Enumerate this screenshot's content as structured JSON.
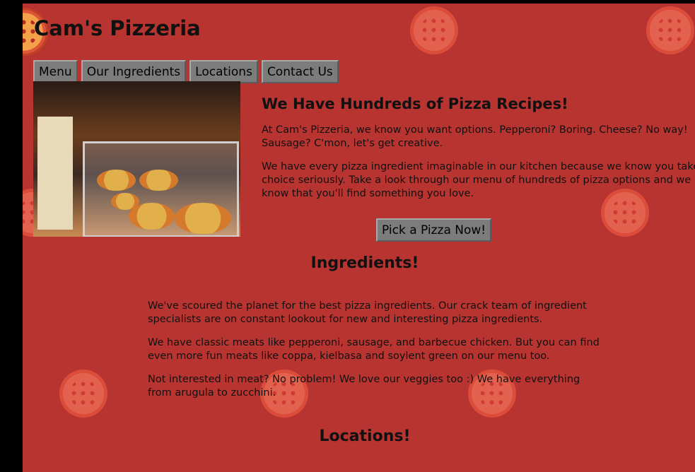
{
  "site_title": "Cam's Pizzeria",
  "nav": [
    {
      "label": "Menu"
    },
    {
      "label": "Our Ingredients"
    },
    {
      "label": "Locations"
    },
    {
      "label": "Contact Us"
    }
  ],
  "hero_image": {
    "icon": "pizzeria-counter-photo"
  },
  "intro": {
    "heading": "We Have Hundreds of Pizza Recipes!",
    "paragraphs": [
      "At Cam's Pizzeria, we know you want options. Pepperoni? Boring. Cheese? No way! Sausage? C'mon, let's get creative.",
      "We have every pizza ingredient imaginable in our kitchen because we know you take choice seriously. Take a look through our menu of hundreds of pizza options and we know that you'll find something you love."
    ],
    "cta_label": "Pick a Pizza Now!"
  },
  "ingredients": {
    "heading": "Ingredients!",
    "paragraphs": [
      "We've scoured the planet for the best pizza ingredients. Our crack team of ingredient specialists are on constant lookout for new and interesting pizza ingredients.",
      "We have classic meats like pepperoni, sausage, and barbecue chicken. But you can find even more fun meats like coppa, kielbasa and soylent green on our menu too.",
      "Not interested in meat? No problem! We love our veggies too :) We have everything from arugula to zucchini."
    ]
  },
  "locations": {
    "heading": "Locations!"
  },
  "colors": {
    "background": "#b83430",
    "button": "#7c7c7c",
    "text": "#111111"
  }
}
